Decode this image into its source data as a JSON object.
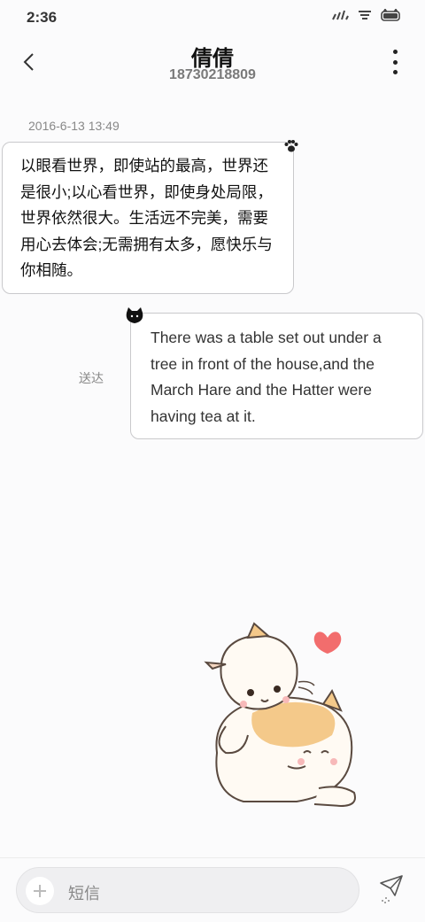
{
  "status_bar": {
    "time": "2:36"
  },
  "header": {
    "contact_name": "倩倩",
    "contact_number": "18730218809"
  },
  "conversation": {
    "timestamp": "2016-6-13 13:49",
    "received_message": "以眼看世界，即使站的最高，世界还是很小;以心看世界，即使身处局限，世界依然很大。生活远不完美，需要用心去体会;无需拥有太多，愿快乐与你相随。",
    "sent_message": "There was a table set out under a tree in front of the house,and the March Hare and the Hatter were having tea at it.",
    "sent_status": "送达"
  },
  "composer": {
    "placeholder": "短信"
  },
  "colors": {
    "background": "#fbfbfc",
    "bubble_border": "#c9c9cc",
    "heart": "#f26d6d",
    "cat_accent": "#f4c98a"
  }
}
